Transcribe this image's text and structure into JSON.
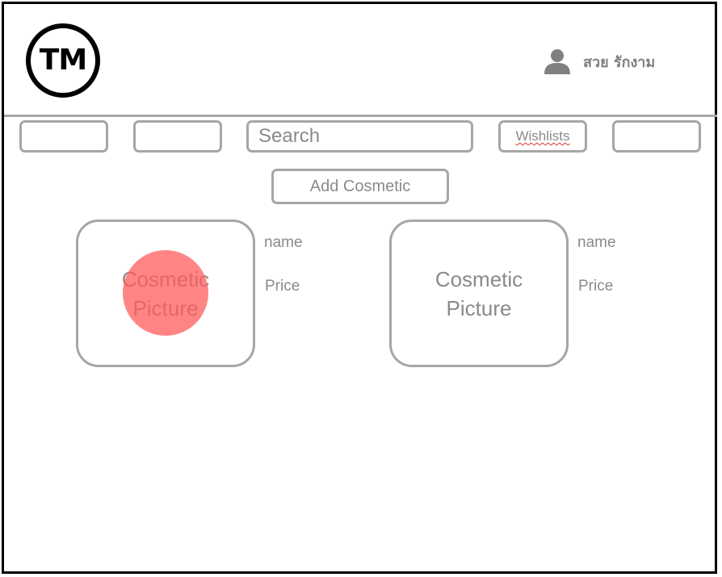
{
  "header": {
    "logo_text": "TM",
    "user_name": "สวย รักงาม"
  },
  "nav": {
    "search_placeholder": "Search",
    "wishlists_label": "Wishlists"
  },
  "actions": {
    "add_cosmetic_label": "Add Cosmetic"
  },
  "products": [
    {
      "picture_label_line1": "Cosmetic",
      "picture_label_line2": "Picture",
      "name_label": "name",
      "price_label": "Price"
    },
    {
      "picture_label_line1": "Cosmetic",
      "picture_label_line2": "Picture",
      "name_label": "name",
      "price_label": "Price"
    }
  ],
  "colors": {
    "border": "#000000",
    "outline_gray": "#a6a6a6",
    "text_gray": "#8a8a8a",
    "marker_red": "#ff5c5c"
  },
  "icons": {
    "user": "user-icon"
  }
}
